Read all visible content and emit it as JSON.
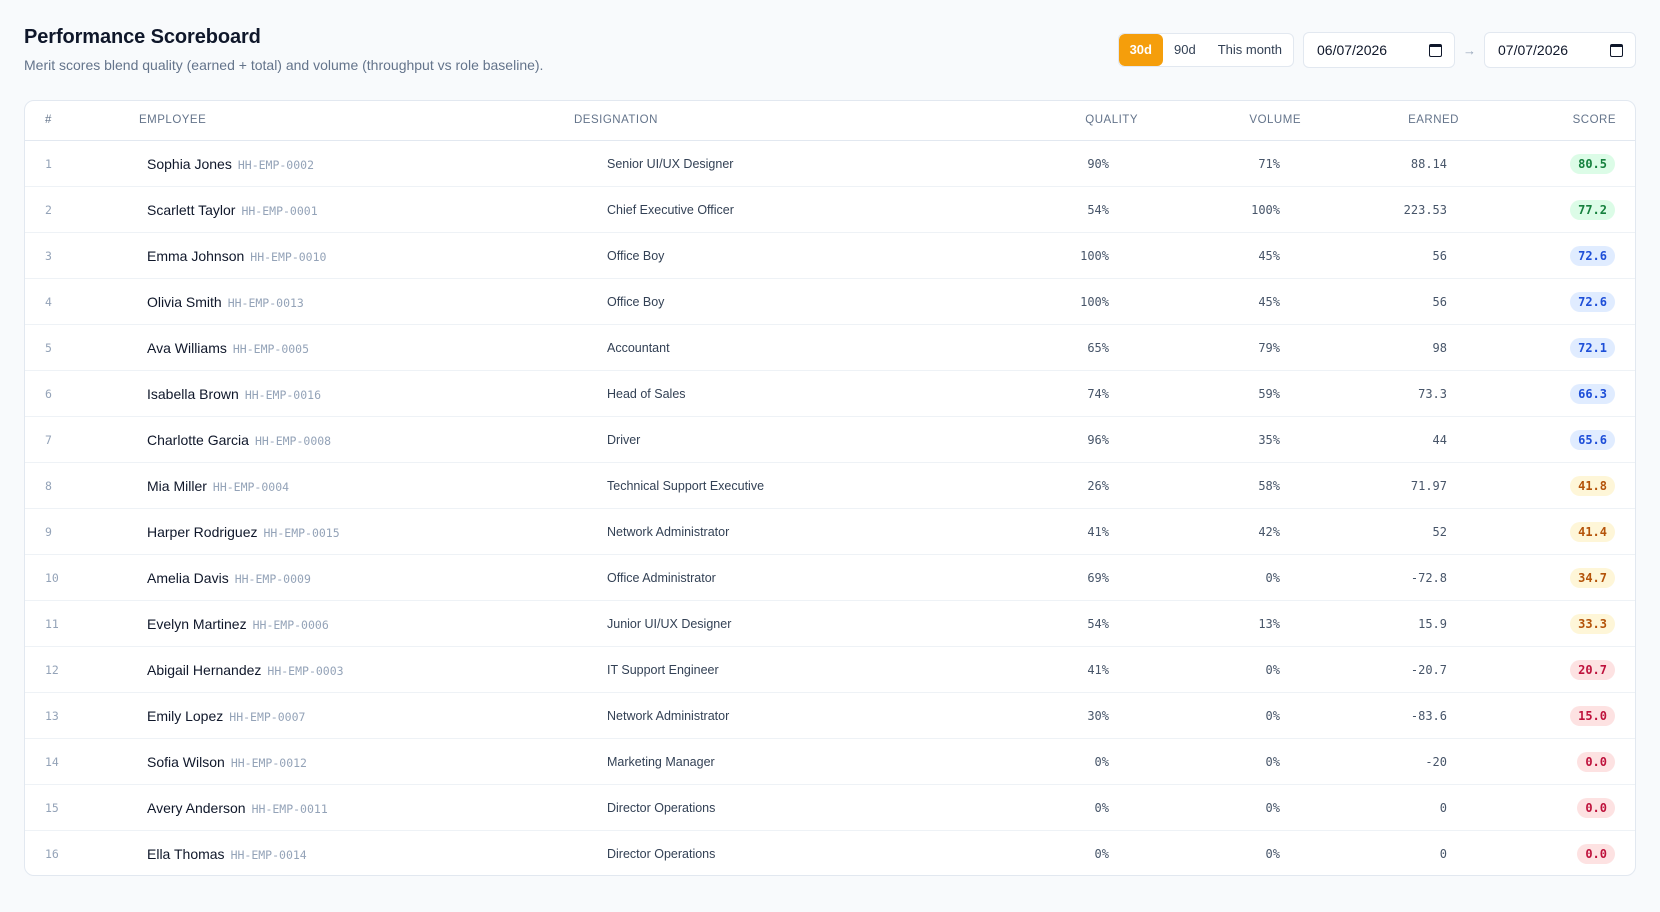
{
  "header": {
    "title": "Performance Scoreboard",
    "subtitle": "Merit scores blend quality (earned + total) and volume (throughput vs role baseline)."
  },
  "controls": {
    "ranges": [
      {
        "label": "30d",
        "active": true
      },
      {
        "label": "90d",
        "active": false
      },
      {
        "label": "This month",
        "active": false
      }
    ],
    "date_from": "06/07/2026",
    "date_to": "07/07/2026",
    "separator": "→"
  },
  "table": {
    "columns": {
      "rank": "#",
      "employee": "EMPLOYEE",
      "designation": "DESIGNATION",
      "quality": "QUALITY",
      "volume": "VOLUME",
      "earned": "EARNED",
      "score": "SCORE"
    },
    "rows": [
      {
        "rank": "1",
        "name": "Sophia Jones",
        "id": "HH-EMP-0002",
        "designation": "Senior UI/UX Designer",
        "quality": "90%",
        "volume": "71%",
        "earned": "88.14",
        "score": "80.5",
        "tier": "green"
      },
      {
        "rank": "2",
        "name": "Scarlett Taylor",
        "id": "HH-EMP-0001",
        "designation": "Chief Executive Officer",
        "quality": "54%",
        "volume": "100%",
        "earned": "223.53",
        "score": "77.2",
        "tier": "green"
      },
      {
        "rank": "3",
        "name": "Emma Johnson",
        "id": "HH-EMP-0010",
        "designation": "Office Boy",
        "quality": "100%",
        "volume": "45%",
        "earned": "56",
        "score": "72.6",
        "tier": "blue"
      },
      {
        "rank": "4",
        "name": "Olivia Smith",
        "id": "HH-EMP-0013",
        "designation": "Office Boy",
        "quality": "100%",
        "volume": "45%",
        "earned": "56",
        "score": "72.6",
        "tier": "blue"
      },
      {
        "rank": "5",
        "name": "Ava Williams",
        "id": "HH-EMP-0005",
        "designation": "Accountant",
        "quality": "65%",
        "volume": "79%",
        "earned": "98",
        "score": "72.1",
        "tier": "blue"
      },
      {
        "rank": "6",
        "name": "Isabella Brown",
        "id": "HH-EMP-0016",
        "designation": "Head of Sales",
        "quality": "74%",
        "volume": "59%",
        "earned": "73.3",
        "score": "66.3",
        "tier": "blue"
      },
      {
        "rank": "7",
        "name": "Charlotte Garcia",
        "id": "HH-EMP-0008",
        "designation": "Driver",
        "quality": "96%",
        "volume": "35%",
        "earned": "44",
        "score": "65.6",
        "tier": "blue"
      },
      {
        "rank": "8",
        "name": "Mia Miller",
        "id": "HH-EMP-0004",
        "designation": "Technical Support Executive",
        "quality": "26%",
        "volume": "58%",
        "earned": "71.97",
        "score": "41.8",
        "tier": "amber"
      },
      {
        "rank": "9",
        "name": "Harper Rodriguez",
        "id": "HH-EMP-0015",
        "designation": "Network Administrator",
        "quality": "41%",
        "volume": "42%",
        "earned": "52",
        "score": "41.4",
        "tier": "amber"
      },
      {
        "rank": "10",
        "name": "Amelia Davis",
        "id": "HH-EMP-0009",
        "designation": "Office Administrator",
        "quality": "69%",
        "volume": "0%",
        "earned": "-72.8",
        "score": "34.7",
        "tier": "amber"
      },
      {
        "rank": "11",
        "name": "Evelyn Martinez",
        "id": "HH-EMP-0006",
        "designation": "Junior UI/UX Designer",
        "quality": "54%",
        "volume": "13%",
        "earned": "15.9",
        "score": "33.3",
        "tier": "amber"
      },
      {
        "rank": "12",
        "name": "Abigail Hernandez",
        "id": "HH-EMP-0003",
        "designation": "IT Support Engineer",
        "quality": "41%",
        "volume": "0%",
        "earned": "-20.7",
        "score": "20.7",
        "tier": "red"
      },
      {
        "rank": "13",
        "name": "Emily Lopez",
        "id": "HH-EMP-0007",
        "designation": "Network Administrator",
        "quality": "30%",
        "volume": "0%",
        "earned": "-83.6",
        "score": "15.0",
        "tier": "red"
      },
      {
        "rank": "14",
        "name": "Sofia Wilson",
        "id": "HH-EMP-0012",
        "designation": "Marketing Manager",
        "quality": "0%",
        "volume": "0%",
        "earned": "-20",
        "score": "0.0",
        "tier": "red"
      },
      {
        "rank": "15",
        "name": "Avery Anderson",
        "id": "HH-EMP-0011",
        "designation": "Director Operations",
        "quality": "0%",
        "volume": "0%",
        "earned": "0",
        "score": "0.0",
        "tier": "red"
      },
      {
        "rank": "16",
        "name": "Ella Thomas",
        "id": "HH-EMP-0014",
        "designation": "Director Operations",
        "quality": "0%",
        "volume": "0%",
        "earned": "0",
        "score": "0.0",
        "tier": "red"
      }
    ]
  },
  "colors": {
    "accent": "#f59e0b",
    "green": {
      "bg": "#dcfce7",
      "fg": "#15803d"
    },
    "blue": {
      "bg": "#e0ecff",
      "fg": "#1d4ed8"
    },
    "amber": {
      "bg": "#fef6d8",
      "fg": "#b45309"
    },
    "red": {
      "bg": "#fde2e2",
      "fg": "#be123c"
    }
  },
  "icons": {
    "calendar": "calendar-icon"
  }
}
